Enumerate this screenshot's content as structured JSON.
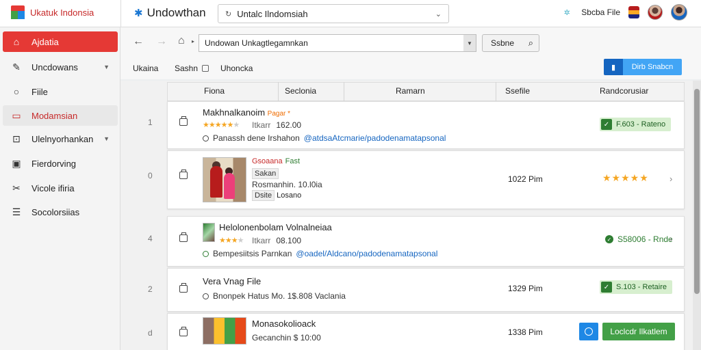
{
  "brand": {
    "name": "Ukatuk Indonsia"
  },
  "app": {
    "title": "Undowthan"
  },
  "top_search": {
    "value": "Untalc Ilndomsiah"
  },
  "top_right": {
    "label": "Sbcba",
    "file_label": "File"
  },
  "sidebar": {
    "items": [
      {
        "label": "Ajdatia",
        "icon": "home-icon",
        "state": "active"
      },
      {
        "label": "Uncdowans",
        "icon": "pencil-icon",
        "expandable": true
      },
      {
        "label": "Fiile",
        "icon": "circle-icon"
      },
      {
        "label": "Modamsian",
        "icon": "document-icon",
        "state": "soft"
      },
      {
        "label": "Ulelnyorhankan",
        "icon": "edit-box-icon",
        "expandable": true
      },
      {
        "label": "Fierdorving",
        "icon": "image-icon"
      },
      {
        "label": "Vicole ifiria",
        "icon": "tools-icon"
      },
      {
        "label": "Socolorsiias",
        "icon": "list-icon"
      }
    ]
  },
  "nav": {
    "url": "Undowan Unkagtlegamnkan",
    "search_label": "Ssbne"
  },
  "toolbar": {
    "items": [
      "Ukaina",
      "Sashn",
      "Uhoncka"
    ],
    "primary_button": "Dirb Snabcn"
  },
  "table": {
    "headers": [
      "Fiona",
      "Seclonia",
      "Ramarn",
      "Ssefile",
      "Randcorusiar"
    ]
  },
  "rows": [
    {
      "num": "1",
      "title": "Makhnalkanoim",
      "title_tag": "Pagar *",
      "rating": 4,
      "meta_key": "Itkarr",
      "meta_value": "162.00",
      "desc": "Panassh dene  Irshahon",
      "desc_link": "@atdsaAtcmarie/padodenamatapsonal",
      "badge": "F.603 - Rateno"
    },
    {
      "num": "0",
      "red_title": "Gsoaana",
      "red_tag": "Fast",
      "label1": "Sakan",
      "meta": "Rosmanhin. 10.l0ia",
      "label2": "Dsite",
      "label2_rest": "Losano",
      "time": "1022 Pim",
      "rating": 5
    },
    {
      "num": "4",
      "title": "Helolonenbolam  Volnalneiaa",
      "rating": 3,
      "meta_key": "Itkarr",
      "meta_value": "08.100",
      "desc": "Bempesiitsis  Parnkan",
      "desc_link": "@oadel/Aldcano/padodenamatapsonal",
      "status": "S58006 - Rnde"
    },
    {
      "num": "2",
      "title": "Vera Vnag File",
      "desc": "Bnonpek  Hatus Mo. 1$.808  Vaclania",
      "time": "1329 Pim",
      "badge": "S.103 - Retaire"
    },
    {
      "num": "d",
      "title": "Monasokolioack",
      "meta": "Gecanchin $ 10:00",
      "time": "1338 Pim",
      "button": "Loclcdr Ilkatlem"
    }
  ],
  "colors": {
    "accent_red": "#e53935",
    "primary_blue": "#1565c0",
    "success_green": "#43a047",
    "star": "#f5a623"
  }
}
